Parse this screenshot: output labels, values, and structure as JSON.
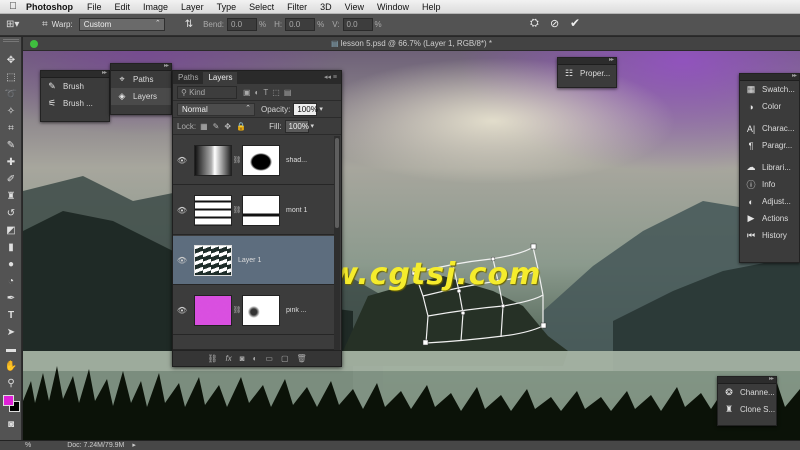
{
  "menubar": {
    "apple": "",
    "app": "Photoshop",
    "menus": [
      "File",
      "Edit",
      "Image",
      "Layer",
      "Type",
      "Select",
      "Filter",
      "3D",
      "View",
      "Window",
      "Help"
    ]
  },
  "options": {
    "warp_label": "Warp:",
    "warp_value": "Custom",
    "bend_label": "Bend:",
    "bend_value": "0.0",
    "bend_unit": "%",
    "h_label": "H:",
    "h_value": "0.0",
    "h_unit": "%",
    "v_label": "V:",
    "v_value": "0.0",
    "v_unit": "%"
  },
  "document": {
    "title": "lesson 5.psd @ 66.7% (Layer 1, RGB/8*) *"
  },
  "watermark": "www.cgtsj.com",
  "left_panel": {
    "items": [
      {
        "label": "Brush",
        "icon": "brush-icon"
      },
      {
        "label": "Brush ...",
        "icon": "brush-presets-icon"
      }
    ]
  },
  "paths_panel": {
    "items": [
      {
        "label": "Paths",
        "icon": "paths-icon"
      },
      {
        "label": "Layers",
        "icon": "layers-icon"
      }
    ]
  },
  "layers_panel": {
    "tabs": [
      "Paths",
      "Layers"
    ],
    "kind_placeholder": "Kind",
    "blend_mode": "Normal",
    "opacity_label": "Opacity:",
    "opacity_value": "100%",
    "lock_label": "Lock:",
    "fill_label": "Fill:",
    "fill_value": "100%",
    "layers": [
      {
        "name": "shad...",
        "visible": true,
        "selected": false
      },
      {
        "name": "mont 1",
        "visible": true,
        "selected": false
      },
      {
        "name": "Layer 1",
        "visible": true,
        "selected": true
      },
      {
        "name": "pink ...",
        "visible": true,
        "selected": false
      }
    ],
    "bottom_icons": [
      "link",
      "fx",
      "mask",
      "adjust",
      "folder",
      "new",
      "trash"
    ]
  },
  "properties_panel": {
    "label": "Proper..."
  },
  "right_panel": {
    "items": [
      {
        "label": "Swatch...",
        "icon": "swatches-icon"
      },
      {
        "label": "Color",
        "icon": "color-icon"
      },
      {
        "label": "Charac...",
        "icon": "character-icon"
      },
      {
        "label": "Paragr...",
        "icon": "paragraph-icon"
      },
      {
        "label": "Librari...",
        "icon": "libraries-icon"
      },
      {
        "label": "Info",
        "icon": "info-icon"
      },
      {
        "label": "Adjust...",
        "icon": "adjustments-icon"
      },
      {
        "label": "Actions",
        "icon": "actions-icon"
      },
      {
        "label": "History",
        "icon": "history-icon"
      }
    ]
  },
  "channels_panel": {
    "items": [
      {
        "label": "Channe...",
        "icon": "channels-icon"
      },
      {
        "label": "Clone S...",
        "icon": "clone-source-icon"
      }
    ]
  },
  "status": {
    "zoom": "%",
    "doc": "Doc: 7.24M/79.9M"
  },
  "colors": {
    "foreground": "#e020d8",
    "background": "#000000",
    "watermark": "#f5ec2c"
  }
}
